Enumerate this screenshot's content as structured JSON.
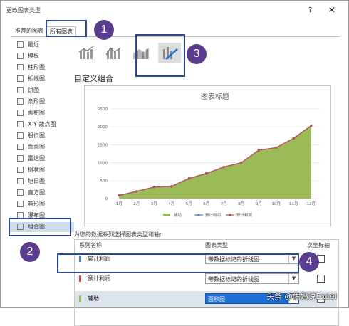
{
  "window": {
    "title": "更改图表类型",
    "help": "?",
    "close": "✕"
  },
  "tabs": [
    {
      "label": "推荐的图表"
    },
    {
      "label": "所有图表"
    }
  ],
  "badges": [
    "1",
    "2",
    "3",
    "4"
  ],
  "sidebar": {
    "items": [
      {
        "label": "最近",
        "icon": "undo-icon"
      },
      {
        "label": "模板",
        "icon": "folder-icon"
      },
      {
        "label": "柱形图",
        "icon": "column-chart-icon"
      },
      {
        "label": "折线图",
        "icon": "line-chart-icon"
      },
      {
        "label": "饼图",
        "icon": "pie-chart-icon"
      },
      {
        "label": "条形图",
        "icon": "bar-chart-icon"
      },
      {
        "label": "面积图",
        "icon": "area-chart-icon"
      },
      {
        "label": "X Y 散点图",
        "icon": "scatter-chart-icon"
      },
      {
        "label": "股价图",
        "icon": "stock-chart-icon"
      },
      {
        "label": "曲面图",
        "icon": "surface-chart-icon"
      },
      {
        "label": "雷达图",
        "icon": "radar-chart-icon"
      },
      {
        "label": "树状图",
        "icon": "treemap-icon"
      },
      {
        "label": "旭日图",
        "icon": "sunburst-icon"
      },
      {
        "label": "直方图",
        "icon": "histogram-icon"
      },
      {
        "label": "箱形图",
        "icon": "boxplot-icon"
      },
      {
        "label": "瀑布图",
        "icon": "waterfall-icon"
      },
      {
        "label": "组合图",
        "icon": "combo-chart-icon"
      }
    ],
    "selected_index": 16
  },
  "main": {
    "section_title": "自定义组合",
    "series_prompt": "为您的数据系列选择图表类型和轴:",
    "headers": {
      "name": "系列名称",
      "type": "图表类型",
      "axis": "次坐标轴"
    },
    "rows": [
      {
        "name": "累计利润",
        "color": "#4a7ebb",
        "type": "带数据标记的折线图",
        "secondary": false
      },
      {
        "name": "预计利润",
        "color": "#c0504d",
        "type": "带数据标记的折线图",
        "secondary": false
      },
      {
        "name": "辅助",
        "color": "#9bbb59",
        "type": "面积图",
        "secondary": false
      }
    ]
  },
  "chart_data": {
    "type": "line",
    "title": "图表标题",
    "categories": [
      "1月",
      "2月",
      "3月",
      "4月",
      "5月",
      "6月",
      "7月",
      "8月",
      "9月",
      "10月",
      "11月",
      "12月"
    ],
    "ylim": [
      0,
      2500
    ],
    "yticks": [
      0,
      500,
      1000,
      1500,
      2000,
      2500
    ],
    "grid": true,
    "legend_position": "bottom",
    "series": [
      {
        "name": "辅助",
        "kind": "area",
        "color": "#9bbb59",
        "values": [
          90,
          200,
          320,
          340,
          560,
          700,
          880,
          1000,
          1350,
          1420,
          1680,
          2030
        ]
      },
      {
        "name": "累计利润",
        "kind": "line",
        "color": "#4a7ebb",
        "values": [
          90,
          200,
          320,
          340,
          560,
          700,
          880,
          1000,
          1350,
          1420,
          1680,
          2030
        ]
      },
      {
        "name": "预计利润",
        "kind": "line",
        "color": "#c0504d",
        "values": [
          90,
          200,
          320,
          340,
          560,
          700,
          880,
          1000,
          1350,
          1420,
          1680,
          2030
        ]
      }
    ]
  },
  "watermark": "头条 @佑妈说Excel"
}
